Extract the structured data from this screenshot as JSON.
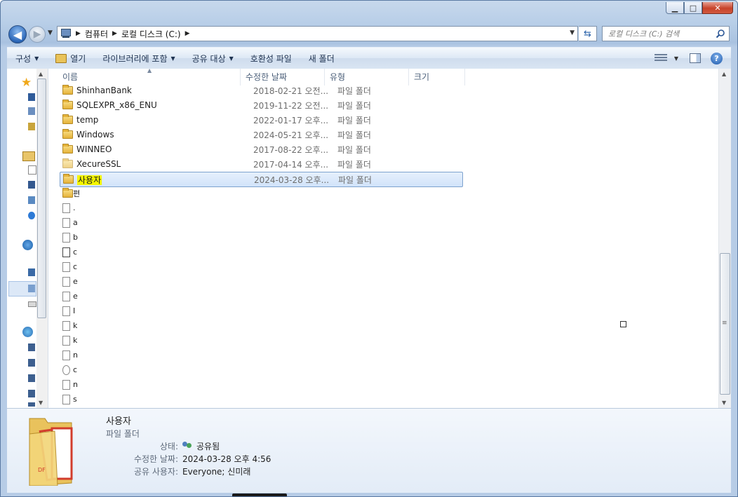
{
  "address": {
    "parts": [
      "컴퓨터",
      "로컬 디스크 (C:)"
    ]
  },
  "search": {
    "placeholder": "로컬 디스크 (C:) 검색"
  },
  "toolbar": {
    "organize": "구성",
    "open": "열기",
    "include_library": "라이브러리에 포함",
    "share_with": "공유 대상",
    "compat_files": "호환성 파일",
    "new_folder": "새 폴더"
  },
  "columns": {
    "name": "이름",
    "modified": "수정한 날짜",
    "type": "유형",
    "size": "크기"
  },
  "files": [
    {
      "name": "ShinhanBank",
      "date": "2018-02-21 오전...",
      "type": "파일 폴더"
    },
    {
      "name": "SQLEXPR_x86_ENU",
      "date": "2019-11-22 오전...",
      "type": "파일 폴더"
    },
    {
      "name": "temp",
      "date": "2022-01-17 오후...",
      "type": "파일 폴더"
    },
    {
      "name": "Windows",
      "date": "2024-05-21 오후...",
      "type": "파일 폴더"
    },
    {
      "name": "WINNEO",
      "date": "2017-08-22 오후...",
      "type": "파일 폴더"
    },
    {
      "name": "XecureSSL",
      "date": "2017-04-14 오후...",
      "type": "파일 폴더"
    },
    {
      "name": "사용자",
      "date": "2024-03-28 오후...",
      "type": "파일 폴더"
    }
  ],
  "partial_items": [
    "편",
    ".",
    "a",
    "b",
    "c",
    "c",
    "e",
    "e",
    "I",
    "k",
    "k",
    "n",
    "c",
    "n",
    "s"
  ],
  "details": {
    "name": "사용자",
    "type": "파일 폴더",
    "status_label": "상태:",
    "status_value": "공유됨",
    "modified_label": "수정한 날짜:",
    "modified_value": "2024-03-28 오후 4:56",
    "shared_label": "공유 사용자:",
    "shared_value": "Everyone; 신미래"
  },
  "colors": {
    "selection": "#d1e3fa",
    "highlight": "#f4f600"
  }
}
